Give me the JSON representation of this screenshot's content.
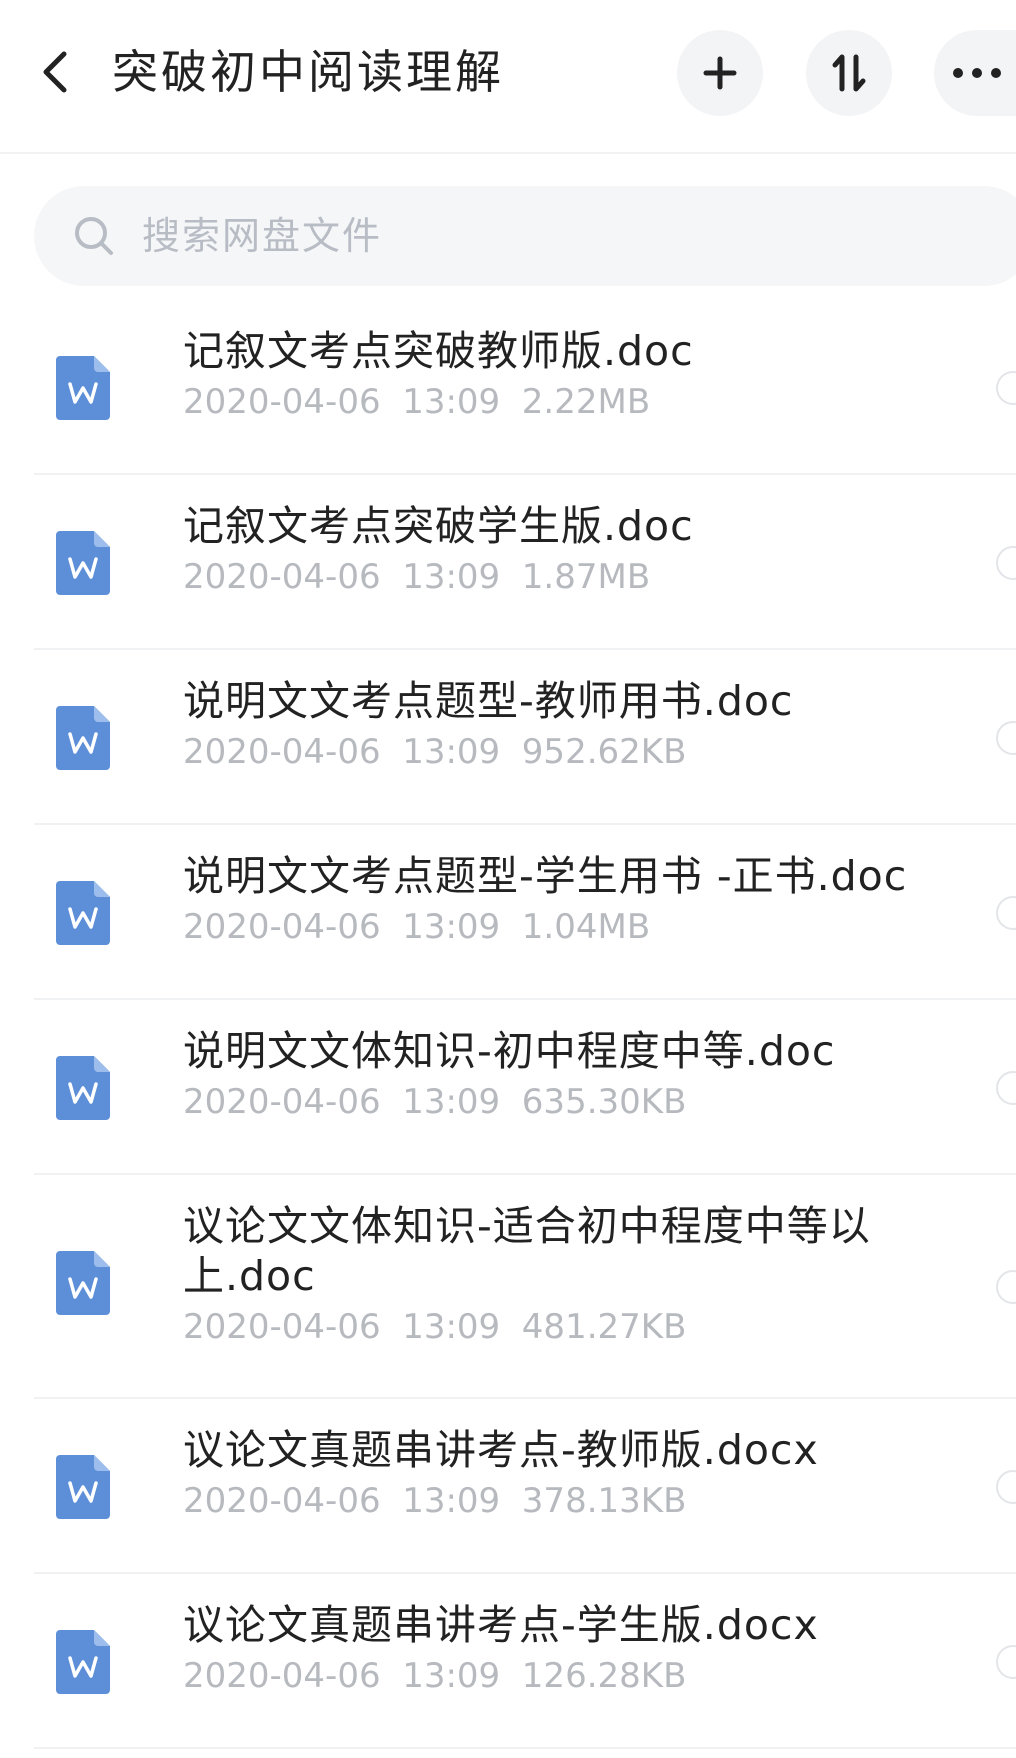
{
  "header": {
    "title": "突破初中阅读理解",
    "back_icon": "chevron-left-icon",
    "add_icon": "plus-icon",
    "sort_icon": "sort-icon",
    "more_icon": "more-dots-icon"
  },
  "search": {
    "placeholder": "搜索网盘文件",
    "icon": "search-icon"
  },
  "colors": {
    "doc_icon": "#5d8fd8",
    "meta_text": "#b6b9be"
  },
  "files": [
    {
      "name": "记叙文考点突破教师版.doc",
      "meta": "2020-04-06  13:09  2.22MB",
      "icon": "word-file-icon"
    },
    {
      "name": "记叙文考点突破学生版.doc",
      "meta": "2020-04-06  13:09  1.87MB",
      "icon": "word-file-icon"
    },
    {
      "name": "说明文文考点题型-教师用书.doc",
      "meta": "2020-04-06  13:09  952.62KB",
      "icon": "word-file-icon"
    },
    {
      "name": "说明文文考点题型-学生用书 -正书.doc",
      "meta": "2020-04-06  13:09  1.04MB",
      "icon": "word-file-icon"
    },
    {
      "name": "说明文文体知识-初中程度中等.doc",
      "meta": "2020-04-06  13:09  635.30KB",
      "icon": "word-file-icon"
    },
    {
      "name": "议论文文体知识-适合初中程度中等以上.doc",
      "meta": "2020-04-06  13:09  481.27KB",
      "icon": "word-file-icon"
    },
    {
      "name": "议论文真题串讲考点-教师版.docx",
      "meta": "2020-04-06  13:09  378.13KB",
      "icon": "word-file-icon"
    },
    {
      "name": "议论文真题串讲考点-学生版.docx",
      "meta": "2020-04-06  13:09  126.28KB",
      "icon": "word-file-icon"
    }
  ]
}
